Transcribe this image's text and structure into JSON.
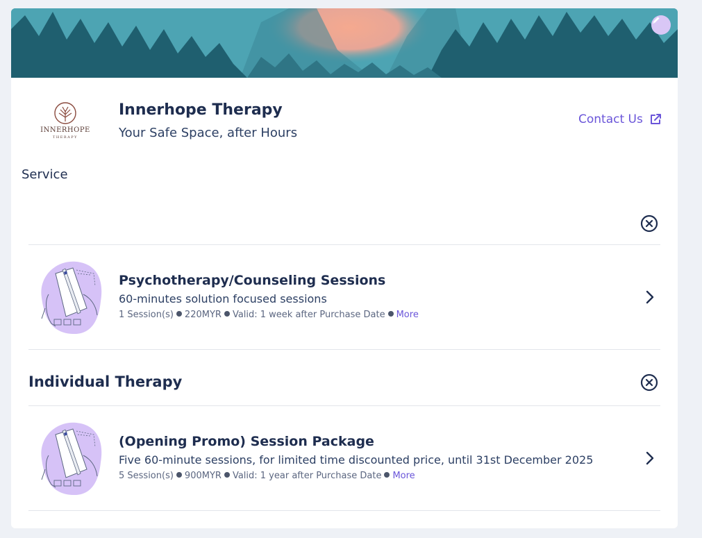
{
  "brand": {
    "name": "Innerhope Therapy",
    "tagline": "Your Safe Space, after Hours",
    "logo_text": "INNERHOPE",
    "logo_subtext": "THERAPY"
  },
  "header": {
    "contact_label": "Contact Us",
    "contact_icon": "external-link-icon",
    "edit_icon": "pencil-icon"
  },
  "section": {
    "title": "Service"
  },
  "groups": [
    {
      "title": "",
      "services": [
        {
          "title": "Psychotherapy/Counseling Sessions",
          "description": "60-minutes solution focused sessions",
          "sessions": "1 Session(s)",
          "price": "220MYR",
          "validity": "Valid: 1 week after Purchase Date",
          "more": "More"
        }
      ]
    },
    {
      "title": "Individual Therapy",
      "services": [
        {
          "title": "(Opening Promo) Session Package",
          "description": "Five 60-minute sessions, for limited time discounted price, until 31st December 2025",
          "sessions": "5 Session(s)",
          "price": "900MYR",
          "validity": "Valid: 1 year after Purchase Date",
          "more": "More"
        }
      ]
    }
  ],
  "colors": {
    "accent": "#6a55d9",
    "heading": "#1e2d4f",
    "illustration": "#d6c2f7"
  }
}
